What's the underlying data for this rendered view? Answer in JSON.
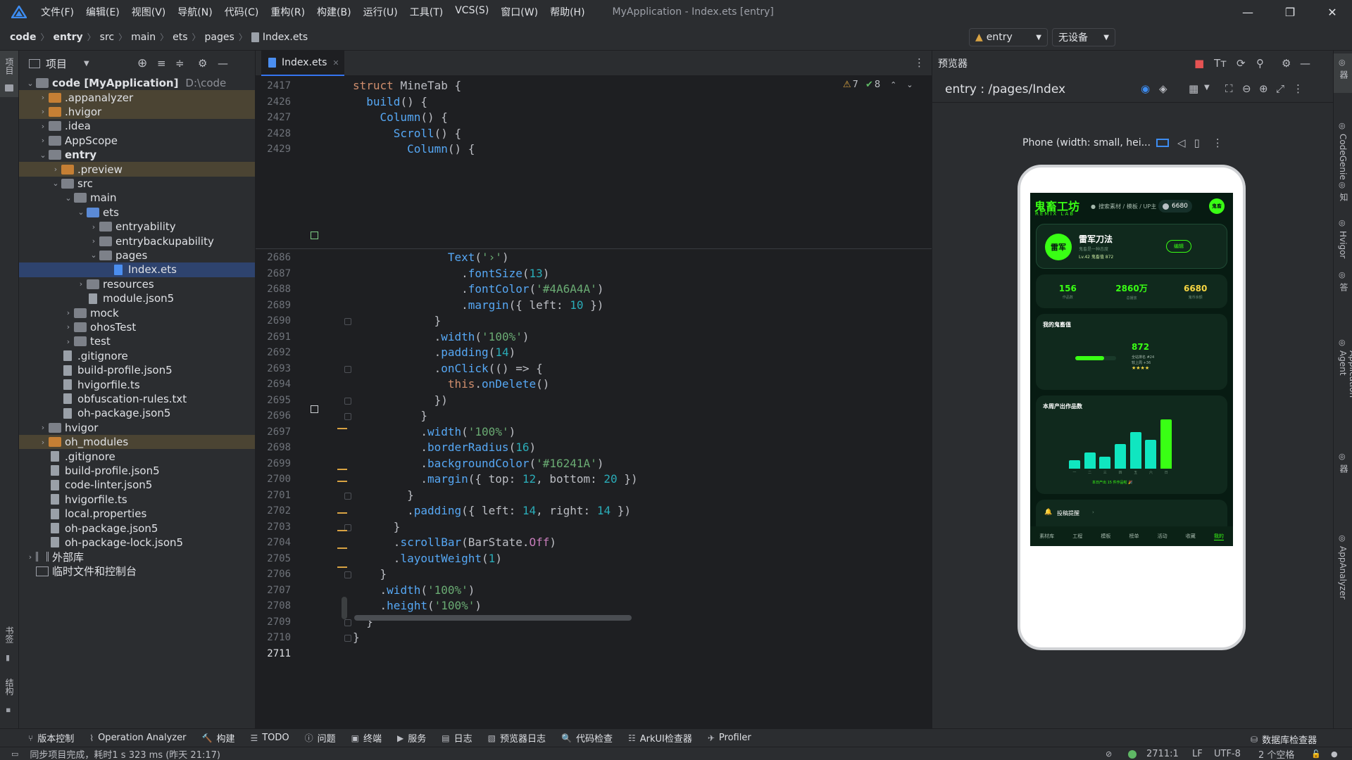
{
  "menu": {
    "items": [
      "文件(F)",
      "编辑(E)",
      "视图(V)",
      "导航(N)",
      "代码(C)",
      "重构(R)",
      "构建(B)",
      "运行(U)",
      "工具(T)",
      "VCS(S)",
      "窗口(W)",
      "帮助(H)"
    ],
    "window_title": "MyApplication - Index.ets [entry]"
  },
  "breadcrumb": [
    "code",
    "entry",
    "src",
    "main",
    "ets",
    "pages",
    "Index.ets"
  ],
  "run_config": {
    "module": "entry",
    "device": "无设备"
  },
  "left_stripe": {
    "project": "项目",
    "bookmarks": "书签",
    "structure": "结构"
  },
  "project_panel": {
    "title": "项目",
    "tree": [
      {
        "label": "code [MyApplication]",
        "suffix": "D:\\code",
        "depth": 0,
        "arrow": "down",
        "icon": "folder",
        "bold": true
      },
      {
        "label": ".appanalyzer",
        "depth": 1,
        "arrow": "right",
        "icon": "folder-orange",
        "hl": true
      },
      {
        "label": ".hvigor",
        "depth": 1,
        "arrow": "right",
        "icon": "folder-orange",
        "hl": true
      },
      {
        "label": ".idea",
        "depth": 1,
        "arrow": "right",
        "icon": "folder"
      },
      {
        "label": "AppScope",
        "depth": 1,
        "arrow": "right",
        "icon": "folder"
      },
      {
        "label": "entry",
        "depth": 1,
        "arrow": "down",
        "icon": "folder",
        "bold": true
      },
      {
        "label": ".preview",
        "depth": 2,
        "arrow": "right",
        "icon": "folder-orange",
        "hl": true
      },
      {
        "label": "src",
        "depth": 2,
        "arrow": "down",
        "icon": "folder"
      },
      {
        "label": "main",
        "depth": 3,
        "arrow": "down",
        "icon": "folder"
      },
      {
        "label": "ets",
        "depth": 4,
        "arrow": "down",
        "icon": "folder-blue"
      },
      {
        "label": "entryability",
        "depth": 5,
        "arrow": "right",
        "icon": "folder"
      },
      {
        "label": "entrybackupability",
        "depth": 5,
        "arrow": "right",
        "icon": "folder"
      },
      {
        "label": "pages",
        "depth": 5,
        "arrow": "down",
        "icon": "folder"
      },
      {
        "label": "Index.ets",
        "depth": 6,
        "arrow": "",
        "icon": "file-ets",
        "sel": true
      },
      {
        "label": "resources",
        "depth": 4,
        "arrow": "right",
        "icon": "folder"
      },
      {
        "label": "module.json5",
        "depth": 4,
        "arrow": "",
        "icon": "file"
      },
      {
        "label": "mock",
        "depth": 3,
        "arrow": "right",
        "icon": "folder"
      },
      {
        "label": "ohosTest",
        "depth": 3,
        "arrow": "right",
        "icon": "folder"
      },
      {
        "label": "test",
        "depth": 3,
        "arrow": "right",
        "icon": "folder"
      },
      {
        "label": ".gitignore",
        "depth": 2,
        "arrow": "",
        "icon": "file"
      },
      {
        "label": "build-profile.json5",
        "depth": 2,
        "arrow": "",
        "icon": "file"
      },
      {
        "label": "hvigorfile.ts",
        "depth": 2,
        "arrow": "",
        "icon": "file"
      },
      {
        "label": "obfuscation-rules.txt",
        "depth": 2,
        "arrow": "",
        "icon": "file"
      },
      {
        "label": "oh-package.json5",
        "depth": 2,
        "arrow": "",
        "icon": "file"
      },
      {
        "label": "hvigor",
        "depth": 1,
        "arrow": "right",
        "icon": "folder"
      },
      {
        "label": "oh_modules",
        "depth": 1,
        "arrow": "right",
        "icon": "folder-orange",
        "hl": true
      },
      {
        "label": ".gitignore",
        "depth": 1,
        "arrow": "",
        "icon": "file"
      },
      {
        "label": "build-profile.json5",
        "depth": 1,
        "arrow": "",
        "icon": "file"
      },
      {
        "label": "code-linter.json5",
        "depth": 1,
        "arrow": "",
        "icon": "file"
      },
      {
        "label": "hvigorfile.ts",
        "depth": 1,
        "arrow": "",
        "icon": "file"
      },
      {
        "label": "local.properties",
        "depth": 1,
        "arrow": "",
        "icon": "file"
      },
      {
        "label": "oh-package.json5",
        "depth": 1,
        "arrow": "",
        "icon": "file"
      },
      {
        "label": "oh-package-lock.json5",
        "depth": 1,
        "arrow": "",
        "icon": "file"
      },
      {
        "label": "外部库",
        "depth": 0,
        "arrow": "right",
        "icon": "lib"
      },
      {
        "label": "临时文件和控制台",
        "depth": 0,
        "arrow": "",
        "icon": "scratch"
      }
    ]
  },
  "editor": {
    "tab": "Index.ets",
    "warnings": "7",
    "checks": "8",
    "sticky_lines": [
      {
        "n": "2417",
        "html": "<span class='kw'>struct</span> <span class='cls' style='color:#bcbec4'>MineTab</span> {"
      },
      {
        "n": "2426",
        "html": "  <span class='fn'>build</span>() {"
      },
      {
        "n": "2427",
        "html": "    <span class='fn'>Column</span>() {"
      },
      {
        "n": "2428",
        "html": "      <span class='fn'>Scroll</span>() {"
      },
      {
        "n": "2429",
        "html": "        <span class='fn'>Column</span>() {"
      }
    ],
    "lines": [
      {
        "n": "2686",
        "html": "              <span class='fn'>Text</span>(<span class='str'>'›'</span>)"
      },
      {
        "n": "2687",
        "html": "                .<span class='fn'>fontSize</span>(<span class='num'>13</span>)"
      },
      {
        "n": "2688",
        "html": "                .<span class='fn'>fontColor</span>(<span class='str'>'#4A6A4A'</span>)"
      },
      {
        "n": "2689",
        "html": "                .<span class='fn'>margin</span>({ left: <span class='num'>10</span> })"
      },
      {
        "n": "2690",
        "html": "            }"
      },
      {
        "n": "2691",
        "html": "            .<span class='fn'>width</span>(<span class='str'>'100%'</span>)"
      },
      {
        "n": "2692",
        "html": "            .<span class='fn'>padding</span>(<span class='num'>14</span>)"
      },
      {
        "n": "2693",
        "html": "            .<span class='fn'>onClick</span>(() => {"
      },
      {
        "n": "2694",
        "html": "              <span class='kw'>this</span>.<span class='fn'>onDelete</span>()"
      },
      {
        "n": "2695",
        "html": "            })"
      },
      {
        "n": "2696",
        "html": "          }"
      },
      {
        "n": "2697",
        "html": "          .<span class='fn'>width</span>(<span class='str'>'100%'</span>)"
      },
      {
        "n": "2698",
        "html": "          .<span class='fn'>borderRadius</span>(<span class='num'>16</span>)"
      },
      {
        "n": "2699",
        "html": "          .<span class='fn'>backgroundColor</span>(<span class='str'>'#16241A'</span>)"
      },
      {
        "n": "2700",
        "html": "          .<span class='fn'>margin</span>({ top: <span class='num'>12</span>, bottom: <span class='num'>20</span> })"
      },
      {
        "n": "2701",
        "html": "        }"
      },
      {
        "n": "2702",
        "html": "        .<span class='fn'>padding</span>({ left: <span class='num'>14</span>, right: <span class='num'>14</span> })"
      },
      {
        "n": "2703",
        "html": "      }"
      },
      {
        "n": "2704",
        "html": "      .<span class='fn'>scrollBar</span>(BarState.<span class='prop'>Off</span>)"
      },
      {
        "n": "2705",
        "html": "      .<span class='fn'>layoutWeight</span>(<span class='num'>1</span>)"
      },
      {
        "n": "2706",
        "html": "    }"
      },
      {
        "n": "2707",
        "html": "    .<span class='fn'>width</span>(<span class='str'>'100%'</span>)"
      },
      {
        "n": "2708",
        "html": "    .<span class='fn'>height</span>(<span class='str'>'100%'</span>)"
      },
      {
        "n": "2709",
        "html": "  }"
      },
      {
        "n": "2710",
        "html": "}"
      },
      {
        "n": "2711",
        "html": ""
      }
    ]
  },
  "preview": {
    "title": "预览器",
    "route": "entry : /pages/Index",
    "device_label": "Phone (width: small, hei...",
    "app": {
      "brand": "鬼畜工坊",
      "brand_sub": "REMIX LAB",
      "search": "搜索素材 / 模板 / UP主",
      "coins": "6680",
      "avatar": "鬼畜",
      "profile_avatar": "雷军",
      "profile_name": "雷军刀法",
      "profile_desc": "鬼畜是一种态度",
      "profile_level": "Lv.42 鬼畜值 872",
      "edit": "编辑",
      "stats": [
        {
          "value": "156",
          "label": "作品数"
        },
        {
          "value": "2860万",
          "label": "总播放"
        },
        {
          "value": "6680",
          "label": "鬼币余额"
        }
      ],
      "score_title": "我的鬼畜值",
      "score_value": "872",
      "score_rank": "全站排名 #24",
      "score_week": "较上周 +36",
      "score_stars": "★★★★",
      "score_progress": 0.7,
      "chart_title": "本周产出作品数",
      "chart_foot": "本日产出 15 件作品啦 🎉",
      "reminder": "投稿提醒",
      "nav": [
        "素材库",
        "工程",
        "模板",
        "榜单",
        "活动",
        "收藏",
        "我的"
      ],
      "nav_active": "我的"
    }
  },
  "chart_data": {
    "type": "bar",
    "title": "本周产出作品数",
    "categories": [
      "一",
      "二",
      "三",
      "四",
      "五",
      "六",
      "日"
    ],
    "values": [
      2,
      4,
      3,
      6,
      9,
      7,
      12
    ],
    "ylim": [
      0,
      12
    ]
  },
  "right_stripe": [
    "预览器",
    "CodeGenie",
    "通知",
    "Hvigor",
    "问题解答",
    "Application Agent",
    "设备文件浏览器",
    "AppAnalyzer"
  ],
  "bottom_tools": [
    {
      "icon": "vcs-icon",
      "glyph": "⑂",
      "label": "版本控制"
    },
    {
      "icon": "analyzer-icon",
      "glyph": "⌇",
      "label": "Operation Analyzer"
    },
    {
      "icon": "build-icon",
      "glyph": "🔨",
      "label": "构建"
    },
    {
      "icon": "todo-icon",
      "glyph": "☰",
      "label": "TODO"
    },
    {
      "icon": "problems-icon",
      "glyph": "ⓘ",
      "label": "问题"
    },
    {
      "icon": "terminal-icon",
      "glyph": "▣",
      "label": "终端"
    },
    {
      "icon": "services-icon",
      "glyph": "▶",
      "label": "服务"
    },
    {
      "icon": "log-icon",
      "glyph": "▤",
      "label": "日志"
    },
    {
      "icon": "preview-log-icon",
      "glyph": "▧",
      "label": "预览器日志"
    },
    {
      "icon": "inspect-icon",
      "glyph": "🔍",
      "label": "代码检查"
    },
    {
      "icon": "arkui-icon",
      "glyph": "☷",
      "label": "ArkUI检查器"
    },
    {
      "icon": "profiler-icon",
      "glyph": "✈",
      "label": "Profiler"
    }
  ],
  "db_inspector": "数据库检查器",
  "status": {
    "message": "同步项目完成，耗时1 s 323 ms (昨天 21:17)",
    "position": "2711:1",
    "line_sep": "LF",
    "encoding": "UTF-8",
    "indent": "2 个空格"
  }
}
